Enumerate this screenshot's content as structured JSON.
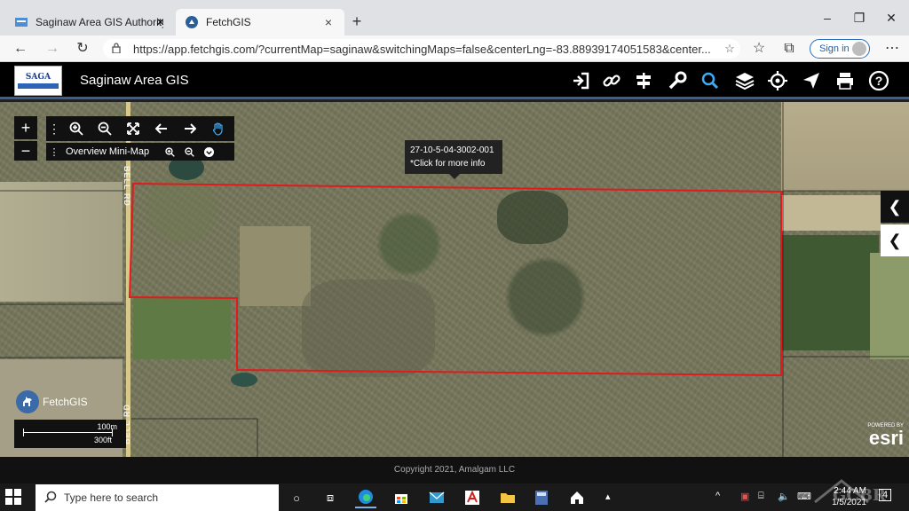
{
  "browser": {
    "tabs": [
      {
        "title": "Saginaw Area GIS Authority",
        "active": false
      },
      {
        "title": "FetchGIS",
        "active": true
      }
    ],
    "url": "https://app.fetchgis.com/?currentMap=saginaw&switchingMaps=false&centerLng=-83.88939174051583&center...",
    "signin_label": "Sign in"
  },
  "app": {
    "title": "Saginaw Area GIS",
    "logo_text": "SAGA",
    "toolbar_icons": [
      "login-icon",
      "link-icon",
      "signpost-icon",
      "wrench-icon",
      "search-icon",
      "layers-icon",
      "gps-icon",
      "send-icon",
      "print-icon",
      "help-icon"
    ],
    "active_tool": "search-icon",
    "accent": "#3fa9f5"
  },
  "map": {
    "zoom_in": "+",
    "zoom_out": "−",
    "minimap_label": "Overview Mini-Map",
    "road_label_top": "BELL RD",
    "road_label_bottom": "BELL RD",
    "parcel_tooltip": {
      "id": "27-10-5-04-3002-001",
      "hint": "*Click for more info"
    },
    "parcel_outline_color": "#e3191b",
    "badge_label": "FetchGIS",
    "scale": {
      "metric": "100m",
      "imperial": "300ft"
    },
    "esri": {
      "powered_by": "POWERED BY",
      "name": "esri"
    }
  },
  "footer": {
    "copyright": "Copyright 2021, Amalgam LLC"
  },
  "taskbar": {
    "search_placeholder": "Type here to search",
    "time": "2:44 AM",
    "date": "1/5/2021",
    "notification_count": "4",
    "watermark": "GCBR"
  }
}
